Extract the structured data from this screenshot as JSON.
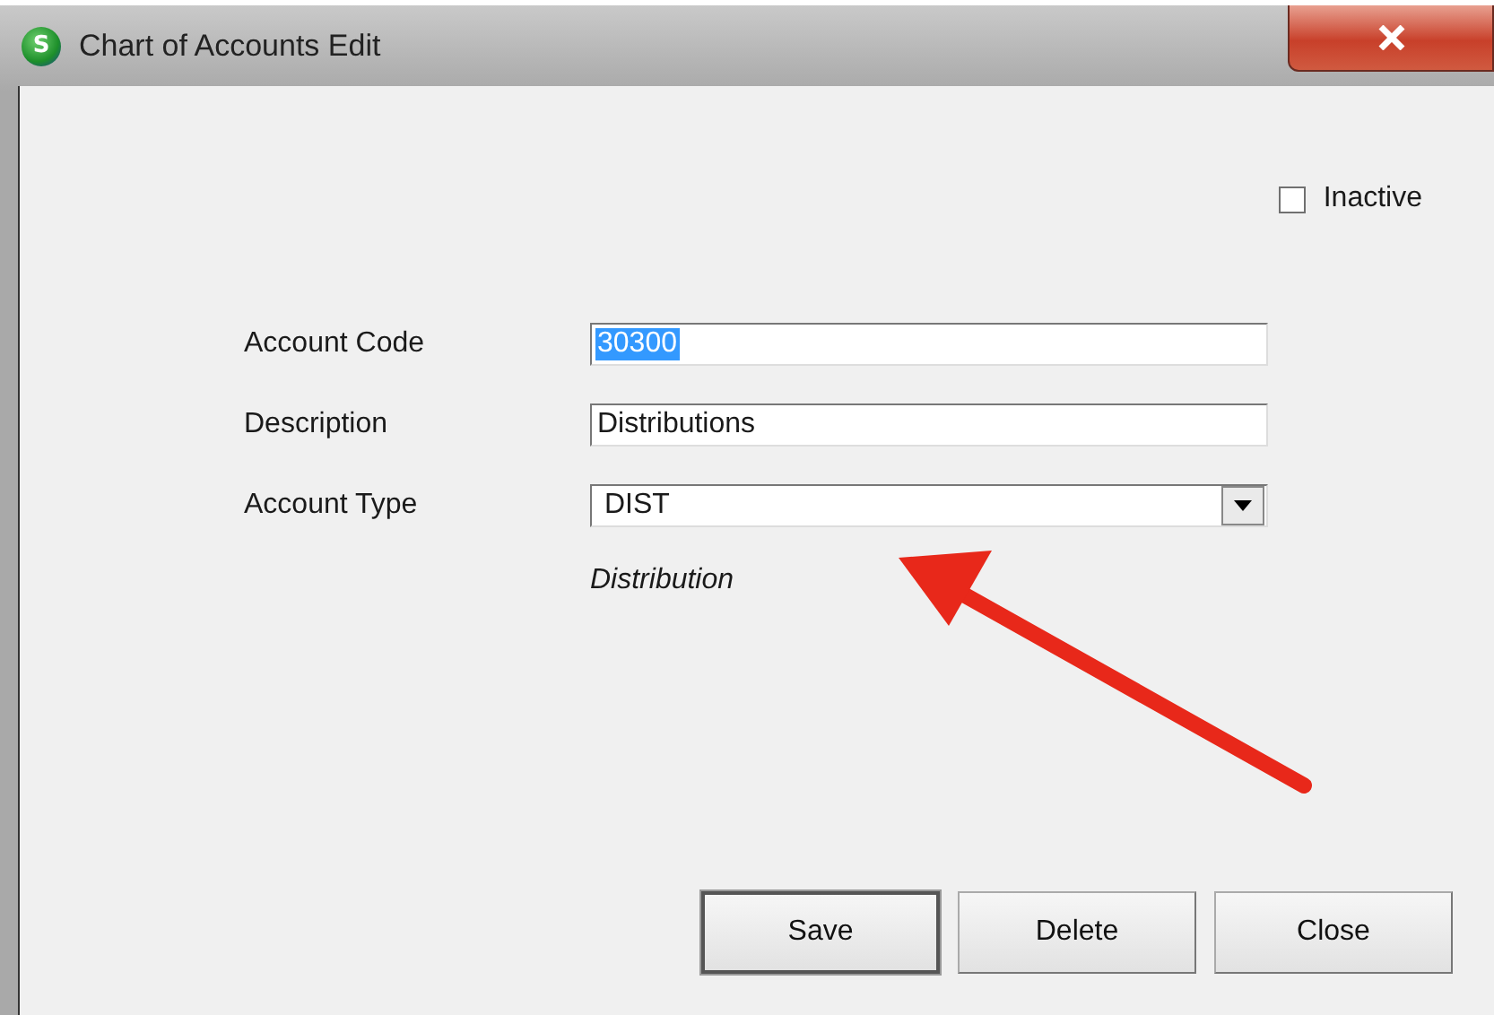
{
  "window": {
    "title": "Chart of Accounts Edit",
    "logo_letter": "S"
  },
  "inactive": {
    "label": "Inactive",
    "checked": false
  },
  "fields": [
    {
      "kind": "text",
      "label": "Account Code",
      "value": "30300",
      "value_selected": true
    },
    {
      "kind": "text",
      "label": "Description",
      "value": "Distributions",
      "value_selected": false
    },
    {
      "kind": "dropdown",
      "label": "Account Type",
      "value": "DIST",
      "value_selected": false
    }
  ],
  "type_description": "Distribution",
  "buttons": [
    {
      "label": "Save",
      "default": true
    },
    {
      "label": "Delete",
      "default": false
    },
    {
      "label": "Close",
      "default": false
    }
  ]
}
